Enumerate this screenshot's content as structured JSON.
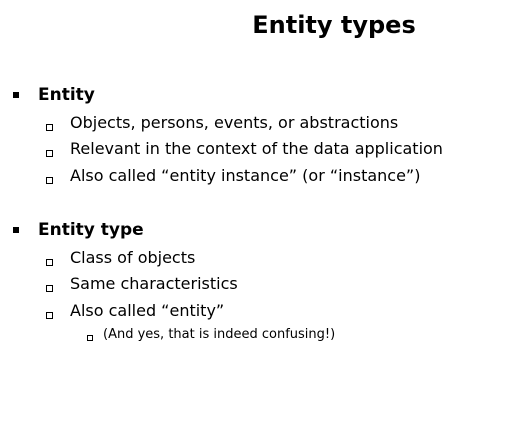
{
  "slide": {
    "title": "Entity types",
    "sections": [
      {
        "heading": "Entity",
        "items": [
          "Objects, persons, events, or abstractions",
          "Relevant in the context of the data application",
          "Also called “entity instance” (or “instance”)"
        ]
      },
      {
        "heading": "Entity type",
        "items": [
          "Class of objects",
          "Same characteristics",
          "Also called “entity”"
        ],
        "subitems": [
          "(And yes, that is indeed confusing!)"
        ]
      }
    ]
  }
}
